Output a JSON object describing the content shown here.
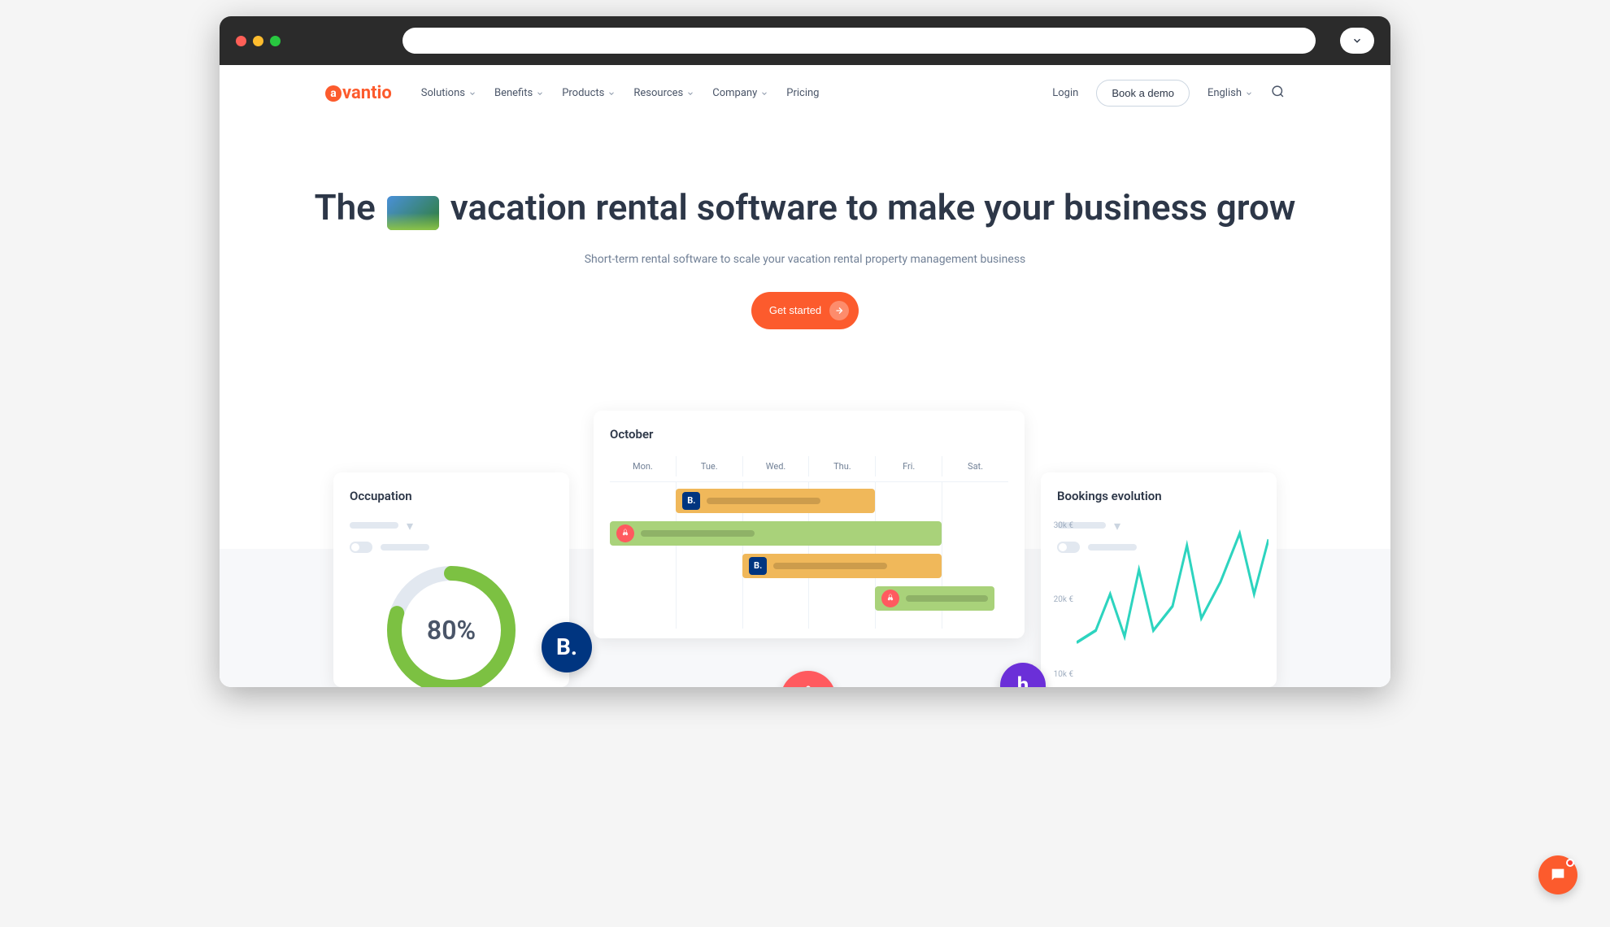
{
  "brand": {
    "name": "avantio",
    "color": "#fc5b2d"
  },
  "nav": {
    "items": [
      {
        "label": "Solutions",
        "hasDropdown": true
      },
      {
        "label": "Benefits",
        "hasDropdown": true
      },
      {
        "label": "Products",
        "hasDropdown": true
      },
      {
        "label": "Resources",
        "hasDropdown": true
      },
      {
        "label": "Company",
        "hasDropdown": true
      },
      {
        "label": "Pricing",
        "hasDropdown": false
      }
    ],
    "login": "Login",
    "demo": "Book a demo",
    "language": "English"
  },
  "hero": {
    "title_pre": "The",
    "title_post": "vacation rental software to make your business grow",
    "subtitle": "Short-term rental software to scale your vacation rental property management business",
    "cta": "Get started"
  },
  "dashboard": {
    "occupation": {
      "title": "Occupation",
      "percent": "80%",
      "percent_value": 80
    },
    "calendar": {
      "month": "October",
      "days": [
        "Mon.",
        "Tue.",
        "Wed.",
        "Thu.",
        "Fri.",
        "Sat."
      ],
      "bookings": [
        {
          "source": "booking",
          "color": "orange",
          "row": 0,
          "start": 1,
          "span": 3
        },
        {
          "source": "airbnb",
          "color": "green",
          "row": 1,
          "start": 0,
          "span": 5
        },
        {
          "source": "booking",
          "color": "orange",
          "row": 2,
          "start": 2,
          "span": 3
        },
        {
          "source": "airbnb",
          "color": "green",
          "row": 3,
          "start": 4,
          "span": 2
        }
      ]
    },
    "bookings_evolution": {
      "title": "Bookings evolution",
      "y_ticks": [
        "30k €",
        "20k €",
        "10k €"
      ]
    }
  }
}
